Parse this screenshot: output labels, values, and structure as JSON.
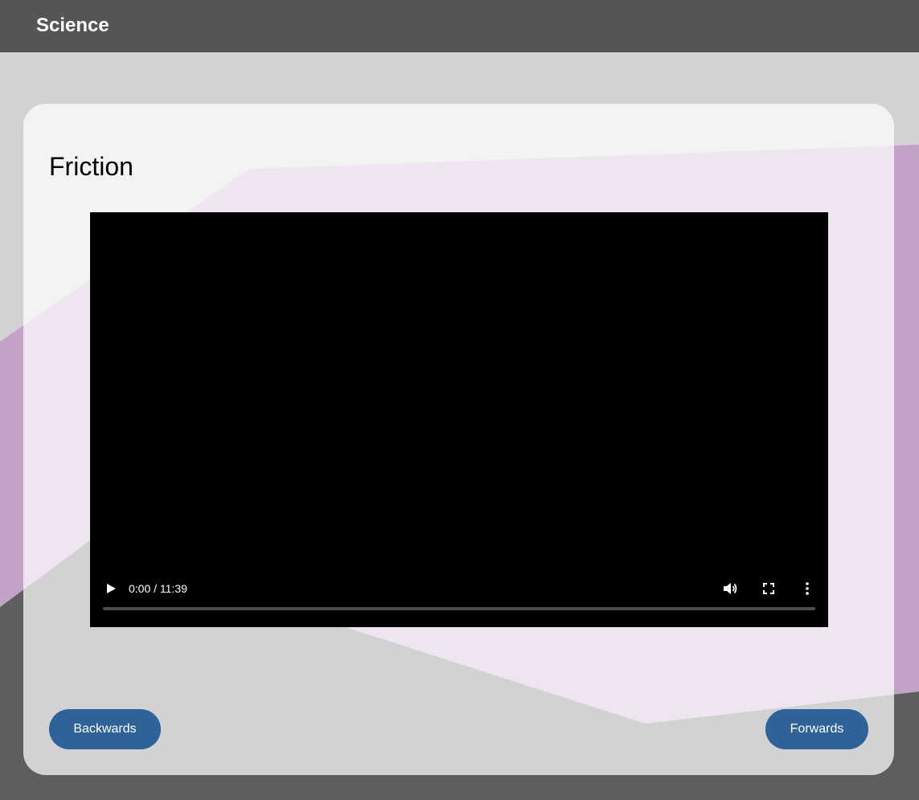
{
  "header": {
    "title": "Science"
  },
  "lesson": {
    "title": "Friction"
  },
  "video": {
    "time_display": "0:00 / 11:39",
    "progress_fraction": 0,
    "controls": {
      "play_icon": "play-icon",
      "volume_icon": "volume-icon",
      "fullscreen_icon": "fullscreen-icon",
      "more_icon": "more-vertical-icon"
    }
  },
  "navigation": {
    "backwards_label": "Backwards",
    "forwards_label": "Forwards"
  },
  "colors": {
    "topbar": "#555555",
    "background": "#5c5c5c",
    "button": "#2e6299",
    "accent_purple": "#c3a2c8"
  }
}
